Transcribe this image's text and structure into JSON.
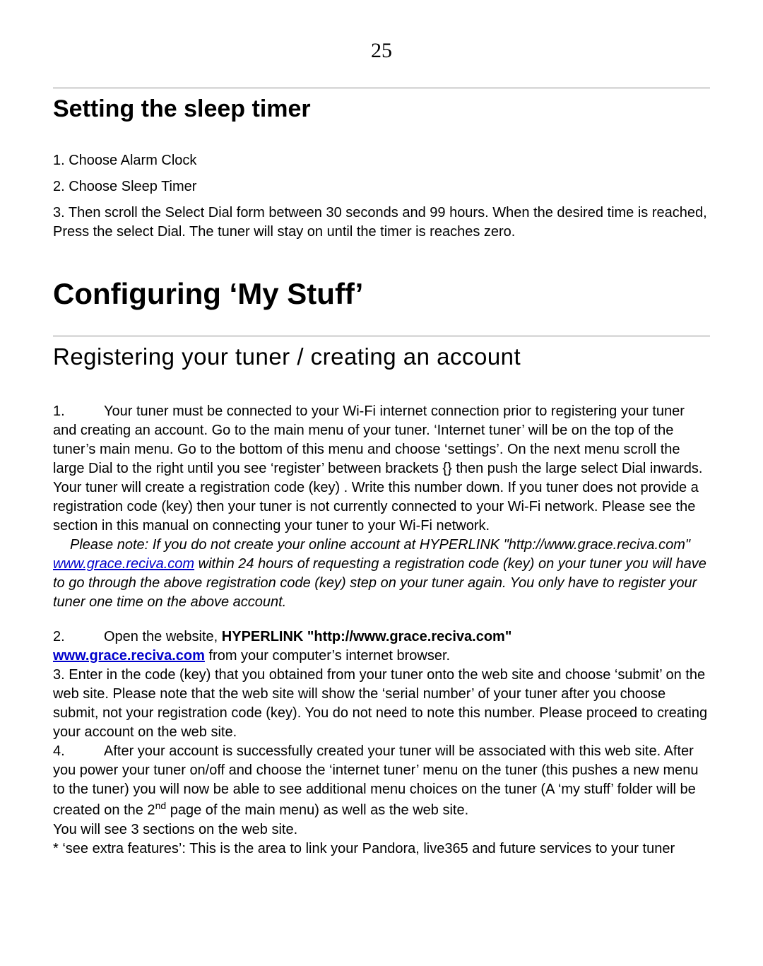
{
  "page_number": "25",
  "sleep": {
    "heading": "Setting the sleep timer",
    "step1": "1. Choose Alarm Clock",
    "step2": "2. Choose Sleep Timer",
    "step3": "3. Then scroll the Select Dial form between 30 seconds and 99 hours. When the desired time is reached, Press the select Dial. The tuner will stay on until the timer is reaches zero."
  },
  "config": {
    "heading": "Configuring ‘My Stuff’"
  },
  "register": {
    "heading": "Registering your tuner / creating an account",
    "p1_num": "1.",
    "p1_text": "Your tuner must be connected to your Wi-Fi internet connection prior to registering your tuner and creating an account.  Go to the main menu of your tuner. ‘Internet tuner’ will be on the top of the tuner’s main menu. Go to the bottom of this menu and choose ‘settings’.  On the next menu scroll the large Dial to the right until you see ‘register’ between brackets {} then push the large select Dial inwards. Your tuner will create a registration code (key)  . Write this number down.  If you tuner does not provide a registration code (key) then your tuner is not currently connected to your Wi-Fi network. Please see the section in this manual on connecting your tuner to your Wi-Fi network.",
    "note_lead": "Please note: If you do not create your online account at HYPERLINK \"http://www.grace.reciva.com\" ",
    "note_link": "www.grace.reciva.com",
    "note_tail": " within 24 hours of requesting a registration code (key) on your tuner you will have to go through the above registration code (key) step on your tuner again. You only have to register your tuner one time on the above account.",
    "p2_num": "2.",
    "p2_a": "Open the website, ",
    "p2_b": "HYPERLINK \"http://www.grace.reciva.com\" ",
    "p2_link": "www.grace.reciva.com",
    "p2_c": "  from your computer’s internet browser.",
    "p3": "3.  Enter in the code (key) that you obtained from your tuner onto the web site and choose ‘submit’ on the web site.  Please note that the web site will show the ‘serial number’ of your tuner after you choose submit, not your registration code (key). You do not need to note this number. Please proceed to creating your account on the web site.",
    "p4_num": "4.",
    "p4_a": "After your account is successfully created your tuner will be associated with this web site.  After you power your tuner on/off and choose the ‘internet tuner’ menu on the tuner (this pushes a new menu to the tuner) you will now be able to see additional menu choices on the tuner (A ‘my stuff’ folder will be created on the 2",
    "p4_sup": "nd",
    "p4_b": " page of the main menu) as well as the web site.",
    "p5": "You will see 3 sections on the web site.",
    "p6": "* ‘see extra features’:  This is the area to link your Pandora, live365 and future services to your tuner"
  }
}
